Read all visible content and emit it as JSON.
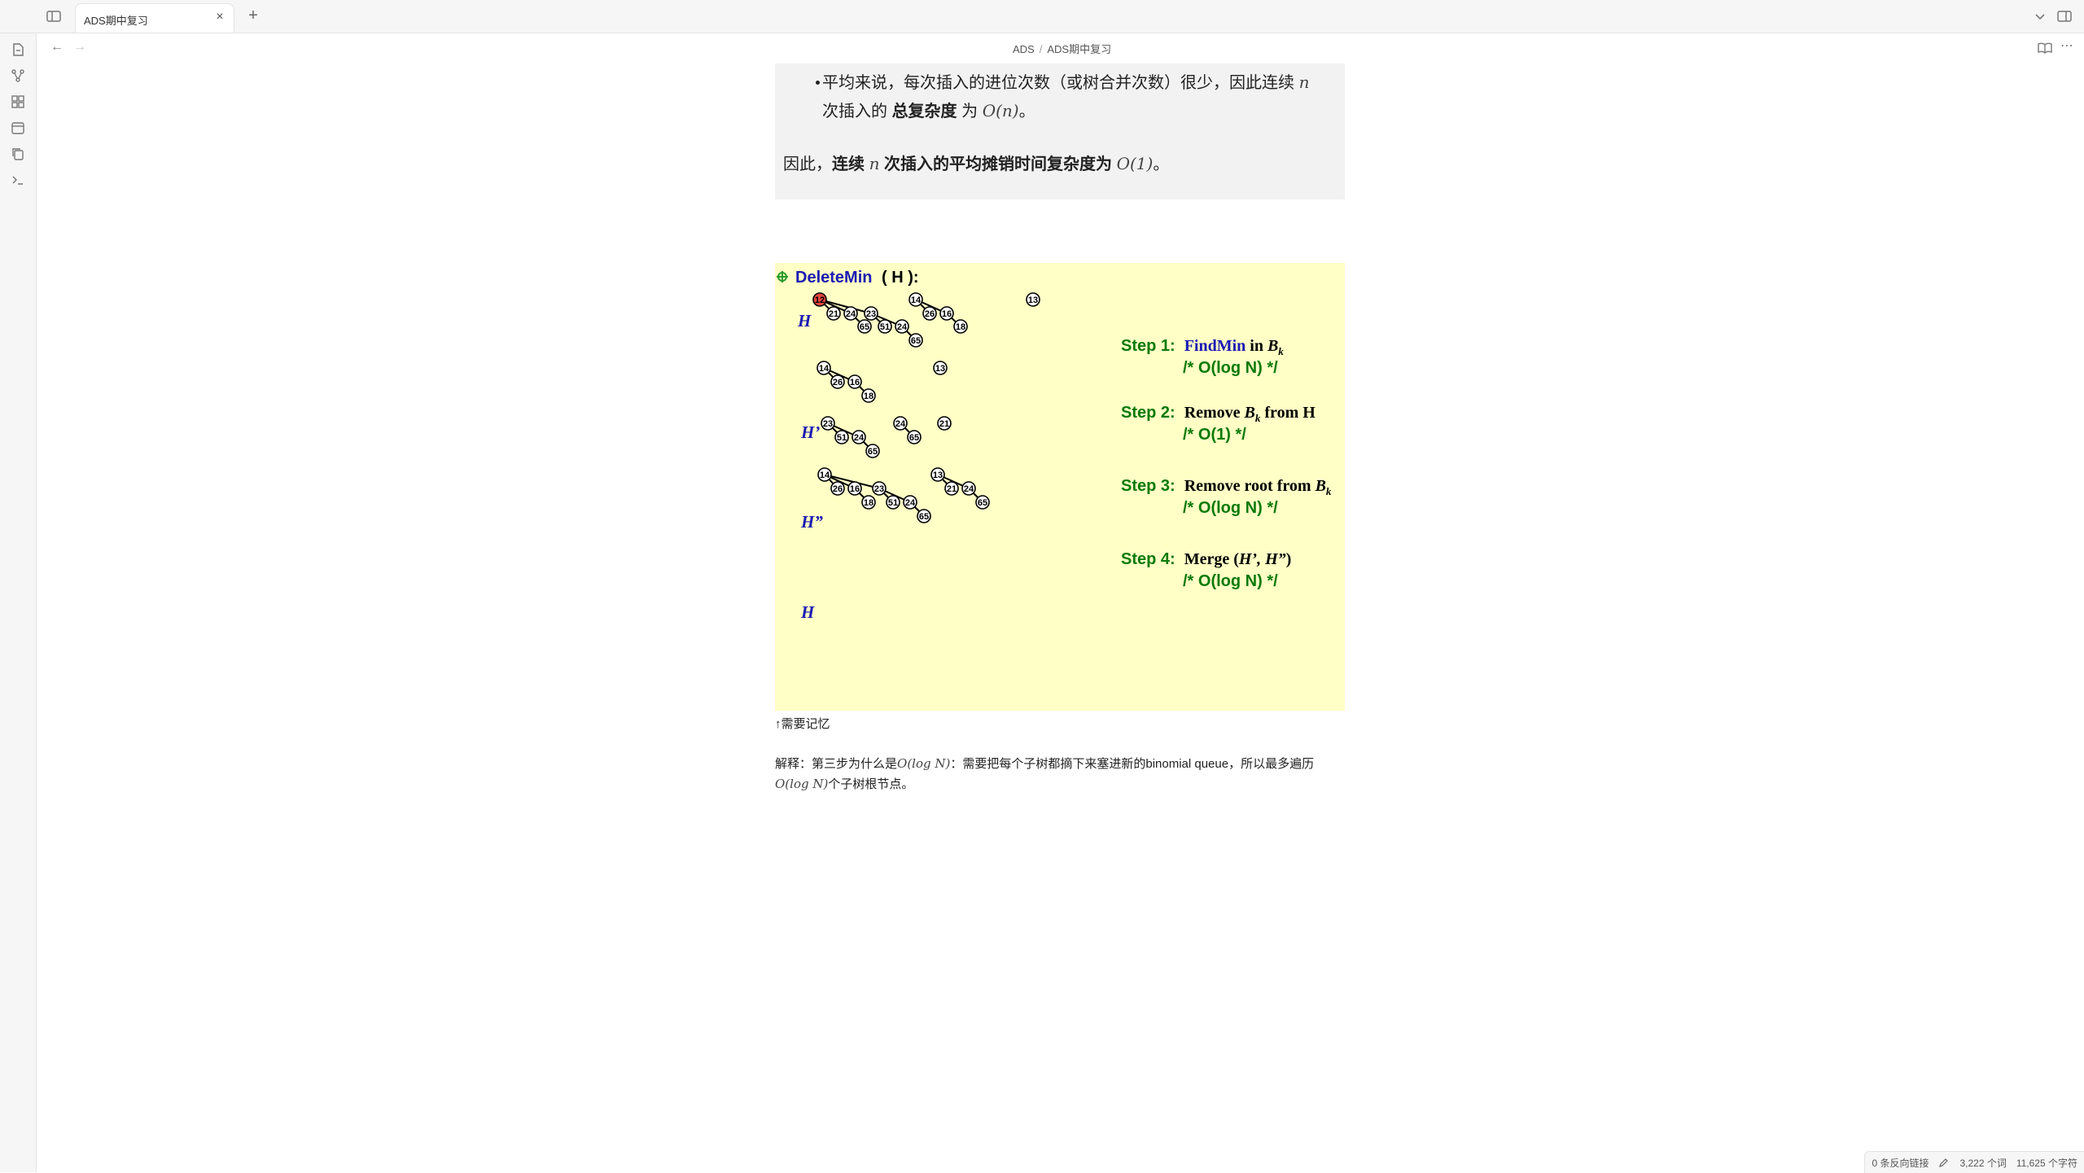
{
  "tabs": [
    {
      "title": "ADS期中复习",
      "active": true
    }
  ],
  "breadcrumb": {
    "folder": "ADS",
    "separator": "/",
    "note": "ADS期中复习"
  },
  "callout": {
    "bullet_prefix": "平均来说，每次插入的进位次数（或树合并次数）很少，因此连续",
    "bullet_var_n": "n",
    "bullet_mid": "次插入的",
    "bullet_bold": "总复杂度",
    "bullet_after": "为",
    "bullet_math": "O(n)",
    "bullet_end": "。",
    "conclusion_pre": "因此，",
    "conclusion_bold_1": "连续",
    "conclusion_var_n": "n",
    "conclusion_bold_2": "次插入的平均摊销时间复杂度为",
    "conclusion_math": "O(1)",
    "conclusion_end": "。"
  },
  "diagram": {
    "title_op": "DeleteMin",
    "title_args": "( H ):",
    "row_labels": [
      "H",
      "H’",
      "H”",
      "H"
    ],
    "steps": [
      {
        "label": "Step 1:",
        "action": "FindMin",
        "rest": " in ",
        "var": "B",
        "sub": "k",
        "tail": "",
        "cost": "/* O(log N) */"
      },
      {
        "label": "Step 2:",
        "action": "Remove",
        "rest": " ",
        "var": "B",
        "sub": "k",
        "tail": " from H",
        "cost": "/* O(1) */"
      },
      {
        "label": "Step 3:",
        "action": "Remove root from",
        "rest": " ",
        "var": "B",
        "sub": "k",
        "tail": "",
        "cost": "/* O(log N) */"
      },
      {
        "label": "Step 4:",
        "action": "Merge",
        "rest": " (",
        "var": "H’, H”",
        "sub": "",
        "tail": ")",
        "cost": "/* O(log N) */"
      }
    ],
    "colors": {
      "background": "#ffffc6",
      "blue": "#1a1ab4",
      "green": "#0a7a0a",
      "min_node": "#e8463e"
    }
  },
  "caption": "↑需要记忆",
  "explanation": {
    "p1": "解释：第三步为什么是",
    "m1": "O(log N)",
    "p2": "：需要把每个子树都摘下来塞进新的binomial queue，所以最多遍历",
    "m2": "O(log N)",
    "p3": "个子树根节点。"
  },
  "status": {
    "backlinks": "0 条反向链接",
    "words": "3,222 个词",
    "chars": "11,625 个字符"
  }
}
